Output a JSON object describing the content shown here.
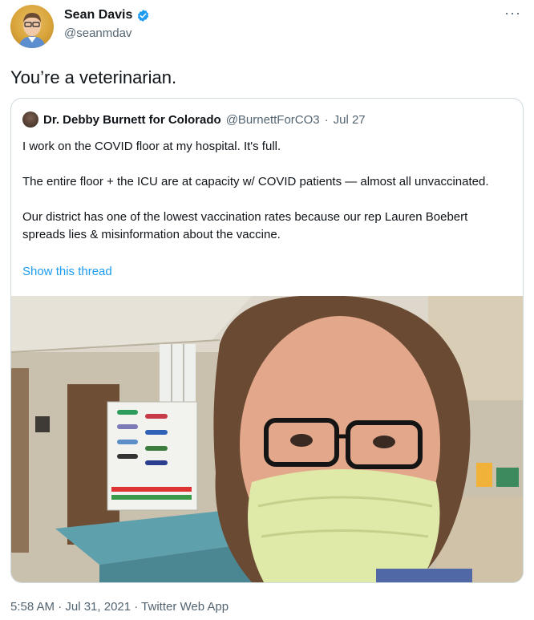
{
  "tweet": {
    "author": {
      "display_name": "Sean Davis",
      "handle": "@seanmdav"
    },
    "more_icon": "···",
    "text": "You’re a veterinarian.",
    "footer": "5:58 AM · Jul 31, 2021 · Twitter Web App"
  },
  "quote": {
    "author_name": "Dr. Debby Burnett for Colorado",
    "author_handle": "@BurnettForCO3",
    "separator": "·",
    "date": "Jul 27",
    "paragraphs": [
      "I work on the COVID floor at my hospital. It's full.",
      "The entire floor + the ICU are at capacity w/ COVID patients — almost all unvaccinated.",
      "Our district has one of the lowest vaccination rates because our rep Lauren Boebert spreads lies & misinformation about the vaccine."
    ],
    "link": "Show this thread"
  },
  "colors": {
    "link": "#1d9bf0",
    "verified": "#1d9bf0",
    "muted": "#536471",
    "border": "#cfd9de"
  }
}
